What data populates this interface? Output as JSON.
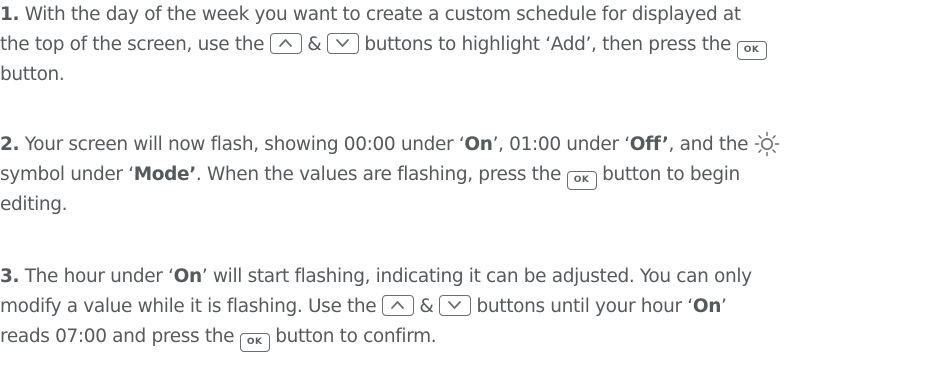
{
  "steps": [
    {
      "number": "1.",
      "l1": " With the day of the week you want to create a custom schedule for displayed at",
      "l2a": "the top of the screen, use the",
      "amp": "&",
      "l2b": "buttons to highlight ‘Add’, then press the",
      "l3": "button."
    },
    {
      "number": "2.",
      "l1a": " Your screen will now flash, showing 00:00 under ‘",
      "on": "On",
      "l1b": "’, 01:00 under ‘",
      "off": "Off’",
      "l1c": ", and the",
      "l2a": "symbol under ‘",
      "mode": "Mode’",
      "l2b": ". When the values are flashing, press the",
      "l2c": "button to begin",
      "l3": "editing."
    },
    {
      "number": "3.",
      "l1a": " The hour under ‘",
      "on": "On",
      "l1b": "’ will start flashing, indicating it can be adjusted. You can only",
      "l2a": "modify a value while it is flashing. Use the",
      "amp": "&",
      "l2b": "buttons until your hour ‘",
      "on2": "On",
      "l2c": "’",
      "l3a": "reads 07:00 and press the",
      "l3b": "button to confirm."
    }
  ],
  "ok_label": "OK",
  "icons": [
    "up-arrow-button-icon",
    "down-arrow-button-icon",
    "ok-button-icon",
    "sun-mode-icon"
  ],
  "colors": {
    "text": "#555a5e",
    "icon_stroke": "#6a6f73"
  }
}
